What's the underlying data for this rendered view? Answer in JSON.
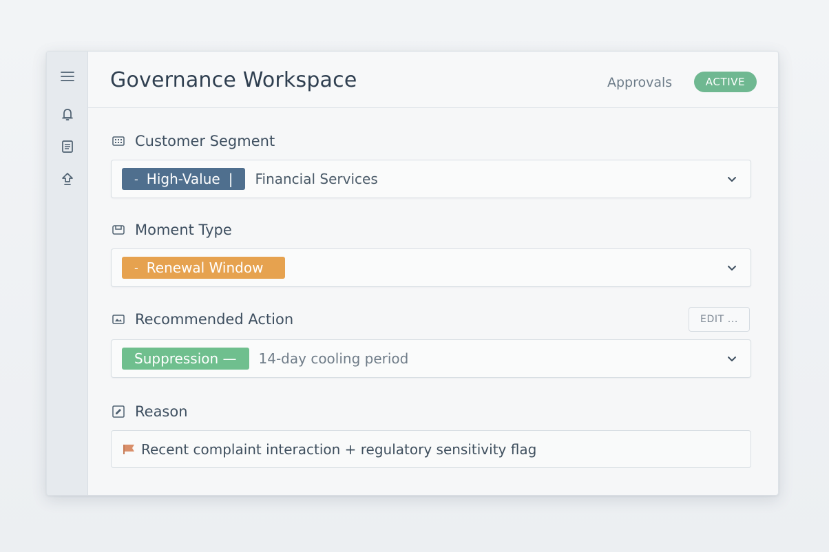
{
  "header": {
    "title": "Governance Workspace",
    "nav_link": "Approvals",
    "status_badge": "ACTIVE"
  },
  "rail": {
    "icons": [
      "menu-icon",
      "bell-icon",
      "document-icon",
      "upload-icon"
    ]
  },
  "segment": {
    "label": "Customer Segment",
    "chip": "High-Value",
    "value": "Financial Services"
  },
  "moment": {
    "label": "Moment Type",
    "chip": "Renewal Window"
  },
  "action": {
    "label": "Recommended Action",
    "edit_label": "EDIT ...",
    "chip": "Suppression —",
    "value": "14-day cooling period"
  },
  "reason": {
    "label": "Reason",
    "text": "Recent complaint interaction + regulatory sensitivity flag"
  },
  "colors": {
    "chip_blue": "#4f6f8e",
    "chip_orange": "#e6a24f",
    "chip_green": "#6fbf8e",
    "badge_green": "#6fb891",
    "flag": "#d98f6a"
  }
}
